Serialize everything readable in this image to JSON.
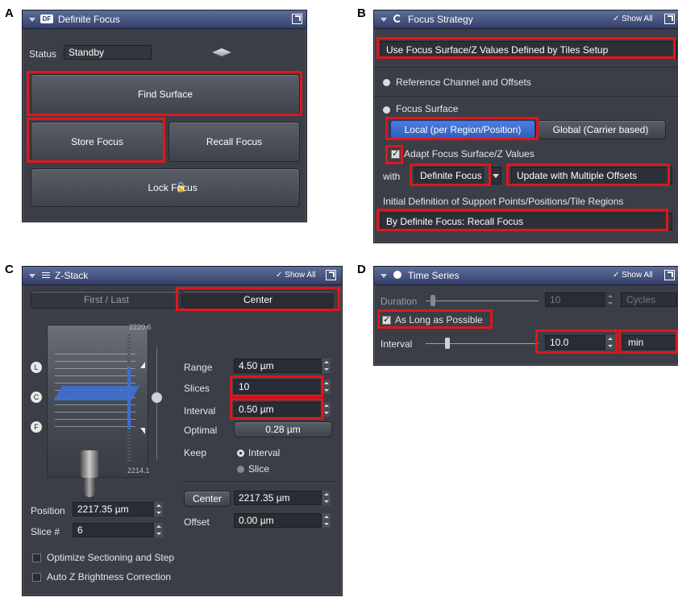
{
  "labels": {
    "a": "A",
    "b": "B",
    "c": "C",
    "d": "D"
  },
  "colors": {
    "panel_bg": "#3b3e47",
    "header": "#4a5680",
    "highlight": "#e0161d",
    "selected_blue": "#3e6fd0"
  },
  "panel_a": {
    "title": "Definite Focus",
    "icon_badge": "DF",
    "status_label": "Status",
    "status_value": "Standby",
    "find_surface": "Find Surface",
    "store_focus": "Store Focus",
    "recall_focus": "Recall Focus",
    "lock_focus": "Lock Focus"
  },
  "panel_b": {
    "title": "Focus Strategy",
    "show_all": "✓ Show All",
    "strategy_select": "Use Focus Surface/Z Values Defined by Tiles Setup",
    "reference_channel": "Reference Channel and Offsets",
    "focus_surface": "Focus Surface",
    "local_btn": "Local (per Region/Position)",
    "global_btn": "Global (Carrier based)",
    "adapt_label": "Adapt Focus Surface/Z Values",
    "adapt_checked": true,
    "with_label": "with",
    "with_select": "Definite Focus",
    "update_select": "Update with Multiple Offsets",
    "initial_def_label": "Initial Definition of Support Points/Positions/Tile Regions",
    "initial_def_select": "By Definite Focus: Recall Focus"
  },
  "panel_c": {
    "title": "Z-Stack",
    "show_all": "✓ Show All",
    "tab_first_last": "First / Last",
    "tab_center": "Center",
    "top_value": "2220.6",
    "bottom_value": "2214.1",
    "marker_l": "L",
    "marker_c": "C",
    "marker_f": "F",
    "range_label": "Range",
    "range_value": "4.50 µm",
    "slices_label": "Slices",
    "slices_value": "10",
    "interval_label": "Interval",
    "interval_value": "0.50 µm",
    "optimal_label": "Optimal",
    "optimal_value": "0.28 µm",
    "keep_label": "Keep",
    "keep_interval": "Interval",
    "keep_slice": "Slice",
    "center_btn": "Center",
    "center_value": "2217.35 µm",
    "offset_label": "Offset",
    "offset_value": "0.00 µm",
    "position_label": "Position",
    "position_value": "2217.35 µm",
    "slice_num_label": "Slice #",
    "slice_num_value": "6",
    "optimize_label": "Optimize Sectioning and Step",
    "auto_z_label": "Auto Z Brightness Correction"
  },
  "panel_d": {
    "title": "Time Series",
    "show_all": "✓ Show All",
    "duration_label": "Duration",
    "duration_value": "10",
    "duration_unit": "Cycles",
    "as_long_label": "As Long as Possible",
    "as_long_checked": true,
    "interval_label": "Interval",
    "interval_value": "10.0",
    "interval_unit": "min"
  }
}
